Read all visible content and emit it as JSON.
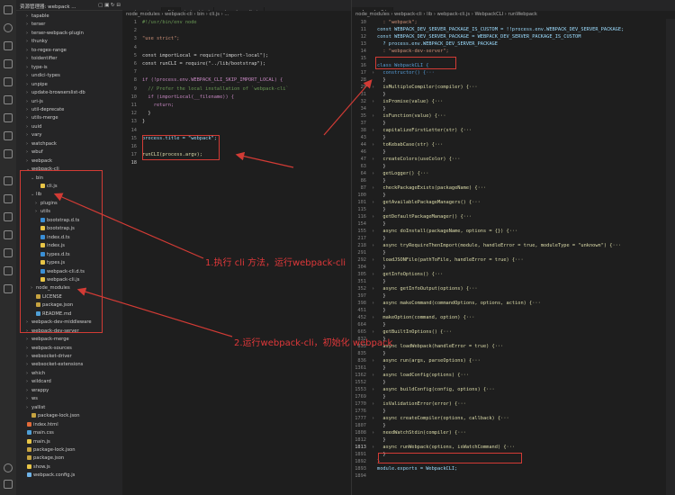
{
  "explorer": {
    "title": "资源管理器: webpack ...",
    "items": [
      {
        "label": "tapable",
        "indent": 0,
        "open": false,
        "folder": true
      },
      {
        "label": "terser",
        "indent": 0,
        "open": false,
        "folder": true
      },
      {
        "label": "terser-webpack-plugin",
        "indent": 0,
        "open": false,
        "folder": true
      },
      {
        "label": "thunky",
        "indent": 0,
        "open": false,
        "folder": true
      },
      {
        "label": "to-regex-range",
        "indent": 0,
        "open": false,
        "folder": true
      },
      {
        "label": "toidentifier",
        "indent": 0,
        "open": false,
        "folder": true
      },
      {
        "label": "type-is",
        "indent": 0,
        "open": false,
        "folder": true
      },
      {
        "label": "undici-types",
        "indent": 0,
        "open": false,
        "folder": true
      },
      {
        "label": "unpipe",
        "indent": 0,
        "open": false,
        "folder": true
      },
      {
        "label": "update-browserslist-db",
        "indent": 0,
        "open": false,
        "folder": true
      },
      {
        "label": "uri-js",
        "indent": 0,
        "open": false,
        "folder": true
      },
      {
        "label": "util-deprecate",
        "indent": 0,
        "open": false,
        "folder": true
      },
      {
        "label": "utils-merge",
        "indent": 0,
        "open": false,
        "folder": true
      },
      {
        "label": "uuid",
        "indent": 0,
        "open": false,
        "folder": true
      },
      {
        "label": "vary",
        "indent": 0,
        "open": false,
        "folder": true
      },
      {
        "label": "watchpack",
        "indent": 0,
        "open": false,
        "folder": true
      },
      {
        "label": "wbuf",
        "indent": 0,
        "open": false,
        "folder": true
      },
      {
        "label": "webpack",
        "indent": 0,
        "open": false,
        "folder": true
      },
      {
        "label": "webpack-cli",
        "indent": 0,
        "open": true,
        "folder": true
      },
      {
        "label": "bin",
        "indent": 1,
        "open": true,
        "folder": true
      },
      {
        "label": "cli.js",
        "indent": 2,
        "open": false,
        "folder": false,
        "color": "#e8c547"
      },
      {
        "label": "lib",
        "indent": 1,
        "open": true,
        "folder": true
      },
      {
        "label": "plugins",
        "indent": 2,
        "open": false,
        "folder": true
      },
      {
        "label": "utils",
        "indent": 2,
        "open": false,
        "folder": true
      },
      {
        "label": "bootstrap.d.ts",
        "indent": 2,
        "open": false,
        "folder": false,
        "color": "#3a8fd6"
      },
      {
        "label": "bootstrap.js",
        "indent": 2,
        "open": false,
        "folder": false,
        "color": "#e8c547"
      },
      {
        "label": "index.d.ts",
        "indent": 2,
        "open": false,
        "folder": false,
        "color": "#3a8fd6"
      },
      {
        "label": "index.js",
        "indent": 2,
        "open": false,
        "folder": false,
        "color": "#e8c547"
      },
      {
        "label": "types.d.ts",
        "indent": 2,
        "open": false,
        "folder": false,
        "color": "#3a8fd6"
      },
      {
        "label": "types.js",
        "indent": 2,
        "open": false,
        "folder": false,
        "color": "#e8c547"
      },
      {
        "label": "webpack-cli.d.ts",
        "indent": 2,
        "open": false,
        "folder": false,
        "color": "#3a8fd6"
      },
      {
        "label": "webpack-cli.js",
        "indent": 2,
        "open": false,
        "folder": false,
        "color": "#e8c547"
      },
      {
        "label": "node_modules",
        "indent": 1,
        "open": false,
        "folder": true
      },
      {
        "label": "LICENSE",
        "indent": 1,
        "open": false,
        "folder": false,
        "color": "#c6a340"
      },
      {
        "label": "package.json",
        "indent": 1,
        "open": false,
        "folder": false,
        "color": "#c6a340"
      },
      {
        "label": "README.md",
        "indent": 1,
        "open": false,
        "folder": false,
        "color": "#4f9fd6"
      },
      {
        "label": "webpack-dev-middleware",
        "indent": 0,
        "open": false,
        "folder": true
      },
      {
        "label": "webpack-dev-server",
        "indent": 0,
        "open": false,
        "folder": true
      },
      {
        "label": "webpack-merge",
        "indent": 0,
        "open": false,
        "folder": true
      },
      {
        "label": "webpack-sources",
        "indent": 0,
        "open": false,
        "folder": true
      },
      {
        "label": "websocket-driver",
        "indent": 0,
        "open": false,
        "folder": true
      },
      {
        "label": "websocket-extensions",
        "indent": 0,
        "open": false,
        "folder": true
      },
      {
        "label": "which",
        "indent": 0,
        "open": false,
        "folder": true
      },
      {
        "label": "wildcard",
        "indent": 0,
        "open": false,
        "folder": true
      },
      {
        "label": "wrappy",
        "indent": 0,
        "open": false,
        "folder": true
      },
      {
        "label": "ws",
        "indent": 0,
        "open": false,
        "folder": true
      },
      {
        "label": "yallist",
        "indent": 0,
        "open": false,
        "folder": true
      },
      {
        "label": "package-lock.json",
        "indent": 0,
        "open": false,
        "folder": false,
        "color": "#c6a340"
      },
      {
        "label": "index.html",
        "indent": -1,
        "open": false,
        "folder": false,
        "color": "#e36b3a"
      },
      {
        "label": "main.css",
        "indent": -1,
        "open": false,
        "folder": false,
        "color": "#4f9fd6"
      },
      {
        "label": "main.js",
        "indent": -1,
        "open": false,
        "folder": false,
        "color": "#e8c547"
      },
      {
        "label": "package-lock.json",
        "indent": -1,
        "open": false,
        "folder": false,
        "color": "#c6a340"
      },
      {
        "label": "package.json",
        "indent": -1,
        "open": false,
        "folder": false,
        "color": "#c6a340"
      },
      {
        "label": "show.js",
        "indent": -1,
        "open": false,
        "folder": false,
        "color": "#e8c547"
      },
      {
        "label": "webpack.config.js",
        "indent": -1,
        "open": false,
        "folder": false,
        "color": "#6fb3e8"
      }
    ]
  },
  "left_editor": {
    "tabs": [
      "package.json",
      "cli.js",
      "index.html",
      "webpack.config.js"
    ],
    "active_tab": 1,
    "breadcrumb": "node_modules › webpack-cli › bin › cli.js › ...",
    "lines": [
      {
        "n": "1",
        "t": "#!/usr/bin/env node",
        "c": "#6a9955"
      },
      {
        "n": "2",
        "t": "",
        "c": "#d4d4d4"
      },
      {
        "n": "3",
        "t": "\"use strict\";",
        "c": "#ce9178"
      },
      {
        "n": "4",
        "t": "",
        "c": "#d4d4d4"
      },
      {
        "n": "5",
        "t": "const importLocal = require(\"import-local\");",
        "c": "#d4d4d4"
      },
      {
        "n": "6",
        "t": "const runCLI = require(\"../lib/bootstrap\");",
        "c": "#d4d4d4"
      },
      {
        "n": "7",
        "t": "",
        "c": "#d4d4d4"
      },
      {
        "n": "8",
        "t": "if (!process.env.WEBPACK_CLI_SKIP_IMPORT_LOCAL) {",
        "c": "#c586c0"
      },
      {
        "n": "9",
        "t": "  // Prefer the local installation of `webpack-cli`",
        "c": "#6a9955"
      },
      {
        "n": "10",
        "t": "  if (importLocal(__filename)) {",
        "c": "#c586c0"
      },
      {
        "n": "11",
        "t": "    return;",
        "c": "#c586c0"
      },
      {
        "n": "12",
        "t": "  }",
        "c": "#d4d4d4"
      },
      {
        "n": "13",
        "t": "}",
        "c": "#d4d4d4"
      },
      {
        "n": "14",
        "t": "",
        "c": "#d4d4d4"
      },
      {
        "n": "15",
        "t": "process.title = \"webpack\";",
        "c": "#9cdcfe"
      },
      {
        "n": "16",
        "t": "",
        "c": "#d4d4d4"
      },
      {
        "n": "17",
        "t": "runCLI(process.argv);",
        "c": "#dcdcaa"
      },
      {
        "n": "18",
        "t": "",
        "c": "#d4d4d4"
      }
    ],
    "current_line": "18"
  },
  "right_editor": {
    "tabs": [
      "webpack-cli.js"
    ],
    "breadcrumb": "node_modules › webpack-cli › lib › webpack-cli.js › WebpackCLI › runWebpack",
    "lines": [
      {
        "n": "10",
        "t": "  : \"webpack\";",
        "c": "#ce9178",
        "f": false
      },
      {
        "n": "11",
        "t": "const WEBPACK_DEV_SERVER_PACKAGE_IS_CUSTOM = !!process.env.WEBPACK_DEV_SERVER_PACKAGE;",
        "c": "#9cdcfe",
        "f": false
      },
      {
        "n": "12",
        "t": "const WEBPACK_DEV_SERVER_PACKAGE = WEBPACK_DEV_SERVER_PACKAGE_IS_CUSTOM",
        "c": "#9cdcfe",
        "f": false
      },
      {
        "n": "13",
        "t": "  ? process.env.WEBPACK_DEV_SERVER_PACKAGE",
        "c": "#9cdcfe",
        "f": false
      },
      {
        "n": "14",
        "t": "  : \"webpack-dev-server\";",
        "c": "#ce9178",
        "f": false
      },
      {
        "n": "15",
        "t": "",
        "c": "#d4d4d4",
        "f": false
      },
      {
        "n": "16",
        "t": "class WebpackCLI {",
        "c": "#569cd6",
        "f": false
      },
      {
        "n": "17",
        "t": "  constructor() {···",
        "c": "#569cd6",
        "f": true
      },
      {
        "n": "28",
        "t": "  }",
        "c": "#d4d4d4",
        "f": false
      },
      {
        "n": "29",
        "t": "  isMultipleCompiler(compiler) {···",
        "c": "#dcdcaa",
        "f": true
      },
      {
        "n": "31",
        "t": "  }",
        "c": "#d4d4d4",
        "f": false
      },
      {
        "n": "32",
        "t": "  isPromise(value) {···",
        "c": "#dcdcaa",
        "f": true
      },
      {
        "n": "34",
        "t": "  }",
        "c": "#d4d4d4",
        "f": false
      },
      {
        "n": "35",
        "t": "  isFunction(value) {···",
        "c": "#dcdcaa",
        "f": true
      },
      {
        "n": "37",
        "t": "  }",
        "c": "#d4d4d4",
        "f": false
      },
      {
        "n": "38",
        "t": "  capitalizeFirstLetter(str) {···",
        "c": "#dcdcaa",
        "f": true
      },
      {
        "n": "43",
        "t": "  }",
        "c": "#d4d4d4",
        "f": false
      },
      {
        "n": "44",
        "t": "  toKebabCase(str) {···",
        "c": "#dcdcaa",
        "f": true
      },
      {
        "n": "46",
        "t": "  }",
        "c": "#d4d4d4",
        "f": false
      },
      {
        "n": "47",
        "t": "  createColors(useColor) {···",
        "c": "#dcdcaa",
        "f": true
      },
      {
        "n": "63",
        "t": "  }",
        "c": "#d4d4d4",
        "f": false
      },
      {
        "n": "64",
        "t": "  getLogger() {···",
        "c": "#dcdcaa",
        "f": true
      },
      {
        "n": "86",
        "t": "  }",
        "c": "#d4d4d4",
        "f": false
      },
      {
        "n": "87",
        "t": "  checkPackageExists(packageName) {···",
        "c": "#dcdcaa",
        "f": true
      },
      {
        "n": "100",
        "t": "  }",
        "c": "#d4d4d4",
        "f": false
      },
      {
        "n": "101",
        "t": "  getAvailablePackageManagers() {···",
        "c": "#dcdcaa",
        "f": true
      },
      {
        "n": "115",
        "t": "  }",
        "c": "#d4d4d4",
        "f": false
      },
      {
        "n": "116",
        "t": "  getDefaultPackageManager() {···",
        "c": "#dcdcaa",
        "f": true
      },
      {
        "n": "154",
        "t": "  }",
        "c": "#d4d4d4",
        "f": false
      },
      {
        "n": "155",
        "t": "  async doInstall(packageName, options = {}) {···",
        "c": "#dcdcaa",
        "f": true
      },
      {
        "n": "217",
        "t": "  }",
        "c": "#d4d4d4",
        "f": false
      },
      {
        "n": "218",
        "t": "  async tryRequireThenImport(module, handleError = true, moduleType = \"unknown\") {···",
        "c": "#dcdcaa",
        "f": true
      },
      {
        "n": "291",
        "t": "  }",
        "c": "#d4d4d4",
        "f": false
      },
      {
        "n": "292",
        "t": "  loadJSONFile(pathToFile, handleError = true) {···",
        "c": "#dcdcaa",
        "f": true
      },
      {
        "n": "304",
        "t": "  }",
        "c": "#d4d4d4",
        "f": false
      },
      {
        "n": "305",
        "t": "  getInfoOptions() {···",
        "c": "#dcdcaa",
        "f": true
      },
      {
        "n": "351",
        "t": "  }",
        "c": "#d4d4d4",
        "f": false
      },
      {
        "n": "352",
        "t": "  async getInfoOutput(options) {···",
        "c": "#dcdcaa",
        "f": true
      },
      {
        "n": "397",
        "t": "  }",
        "c": "#d4d4d4",
        "f": false
      },
      {
        "n": "398",
        "t": "  async makeCommand(commandOptions, options, action) {···",
        "c": "#dcdcaa",
        "f": true
      },
      {
        "n": "451",
        "t": "  }",
        "c": "#d4d4d4",
        "f": false
      },
      {
        "n": "452",
        "t": "  makeOption(command, option) {···",
        "c": "#dcdcaa",
        "f": true
      },
      {
        "n": "664",
        "t": "  }",
        "c": "#d4d4d4",
        "f": false
      },
      {
        "n": "665",
        "t": "  getBuiltInOptions() {···",
        "c": "#dcdcaa",
        "f": true
      },
      {
        "n": "832",
        "t": "  }",
        "c": "#d4d4d4",
        "f": false
      },
      {
        "n": "833",
        "t": "  async loadWebpack(handleError = true) {···",
        "c": "#dcdcaa",
        "f": true
      },
      {
        "n": "835",
        "t": "  }",
        "c": "#d4d4d4",
        "f": false
      },
      {
        "n": "836",
        "t": "  async run(args, parseOptions) {···",
        "c": "#dcdcaa",
        "f": true
      },
      {
        "n": "1361",
        "t": "  }",
        "c": "#d4d4d4",
        "f": false
      },
      {
        "n": "1362",
        "t": "  async loadConfig(options) {···",
        "c": "#dcdcaa",
        "f": true
      },
      {
        "n": "1552",
        "t": "  }",
        "c": "#d4d4d4",
        "f": false
      },
      {
        "n": "1553",
        "t": "  async buildConfig(config, options) {···",
        "c": "#dcdcaa",
        "f": true
      },
      {
        "n": "1769",
        "t": "  }",
        "c": "#d4d4d4",
        "f": false
      },
      {
        "n": "1770",
        "t": "  isValidationError(error) {···",
        "c": "#dcdcaa",
        "f": true
      },
      {
        "n": "1776",
        "t": "  }",
        "c": "#d4d4d4",
        "f": false
      },
      {
        "n": "1777",
        "t": "  async createCompiler(options, callback) {···",
        "c": "#dcdcaa",
        "f": true
      },
      {
        "n": "1807",
        "t": "  }",
        "c": "#d4d4d4",
        "f": false
      },
      {
        "n": "1808",
        "t": "  needWatchStdin(compiler) {···",
        "c": "#dcdcaa",
        "f": true
      },
      {
        "n": "1812",
        "t": "  }",
        "c": "#d4d4d4",
        "f": false
      },
      {
        "n": "1813",
        "t": "  async runWebpack(options, isWatchCommand) {···",
        "c": "#dcdcaa",
        "f": true
      },
      {
        "n": "1891",
        "t": "  }",
        "c": "#d4d4d4",
        "f": false
      },
      {
        "n": "1892",
        "t": "}",
        "c": "#d4d4d4",
        "f": false
      },
      {
        "n": "1893",
        "t": "module.exports = WebpackCLI;",
        "c": "#9cdcfe",
        "f": false
      },
      {
        "n": "1894",
        "t": "",
        "c": "#d4d4d4",
        "f": false
      }
    ],
    "current_line": "1813"
  },
  "annotations": {
    "a1": "1.执行 cli 方法，运行webpack-cli",
    "a2": "2.运行webpack-cli，初始化 webpack"
  },
  "colors": {
    "accent_red": "#d23b35",
    "annotation_text": "#e0383a"
  }
}
